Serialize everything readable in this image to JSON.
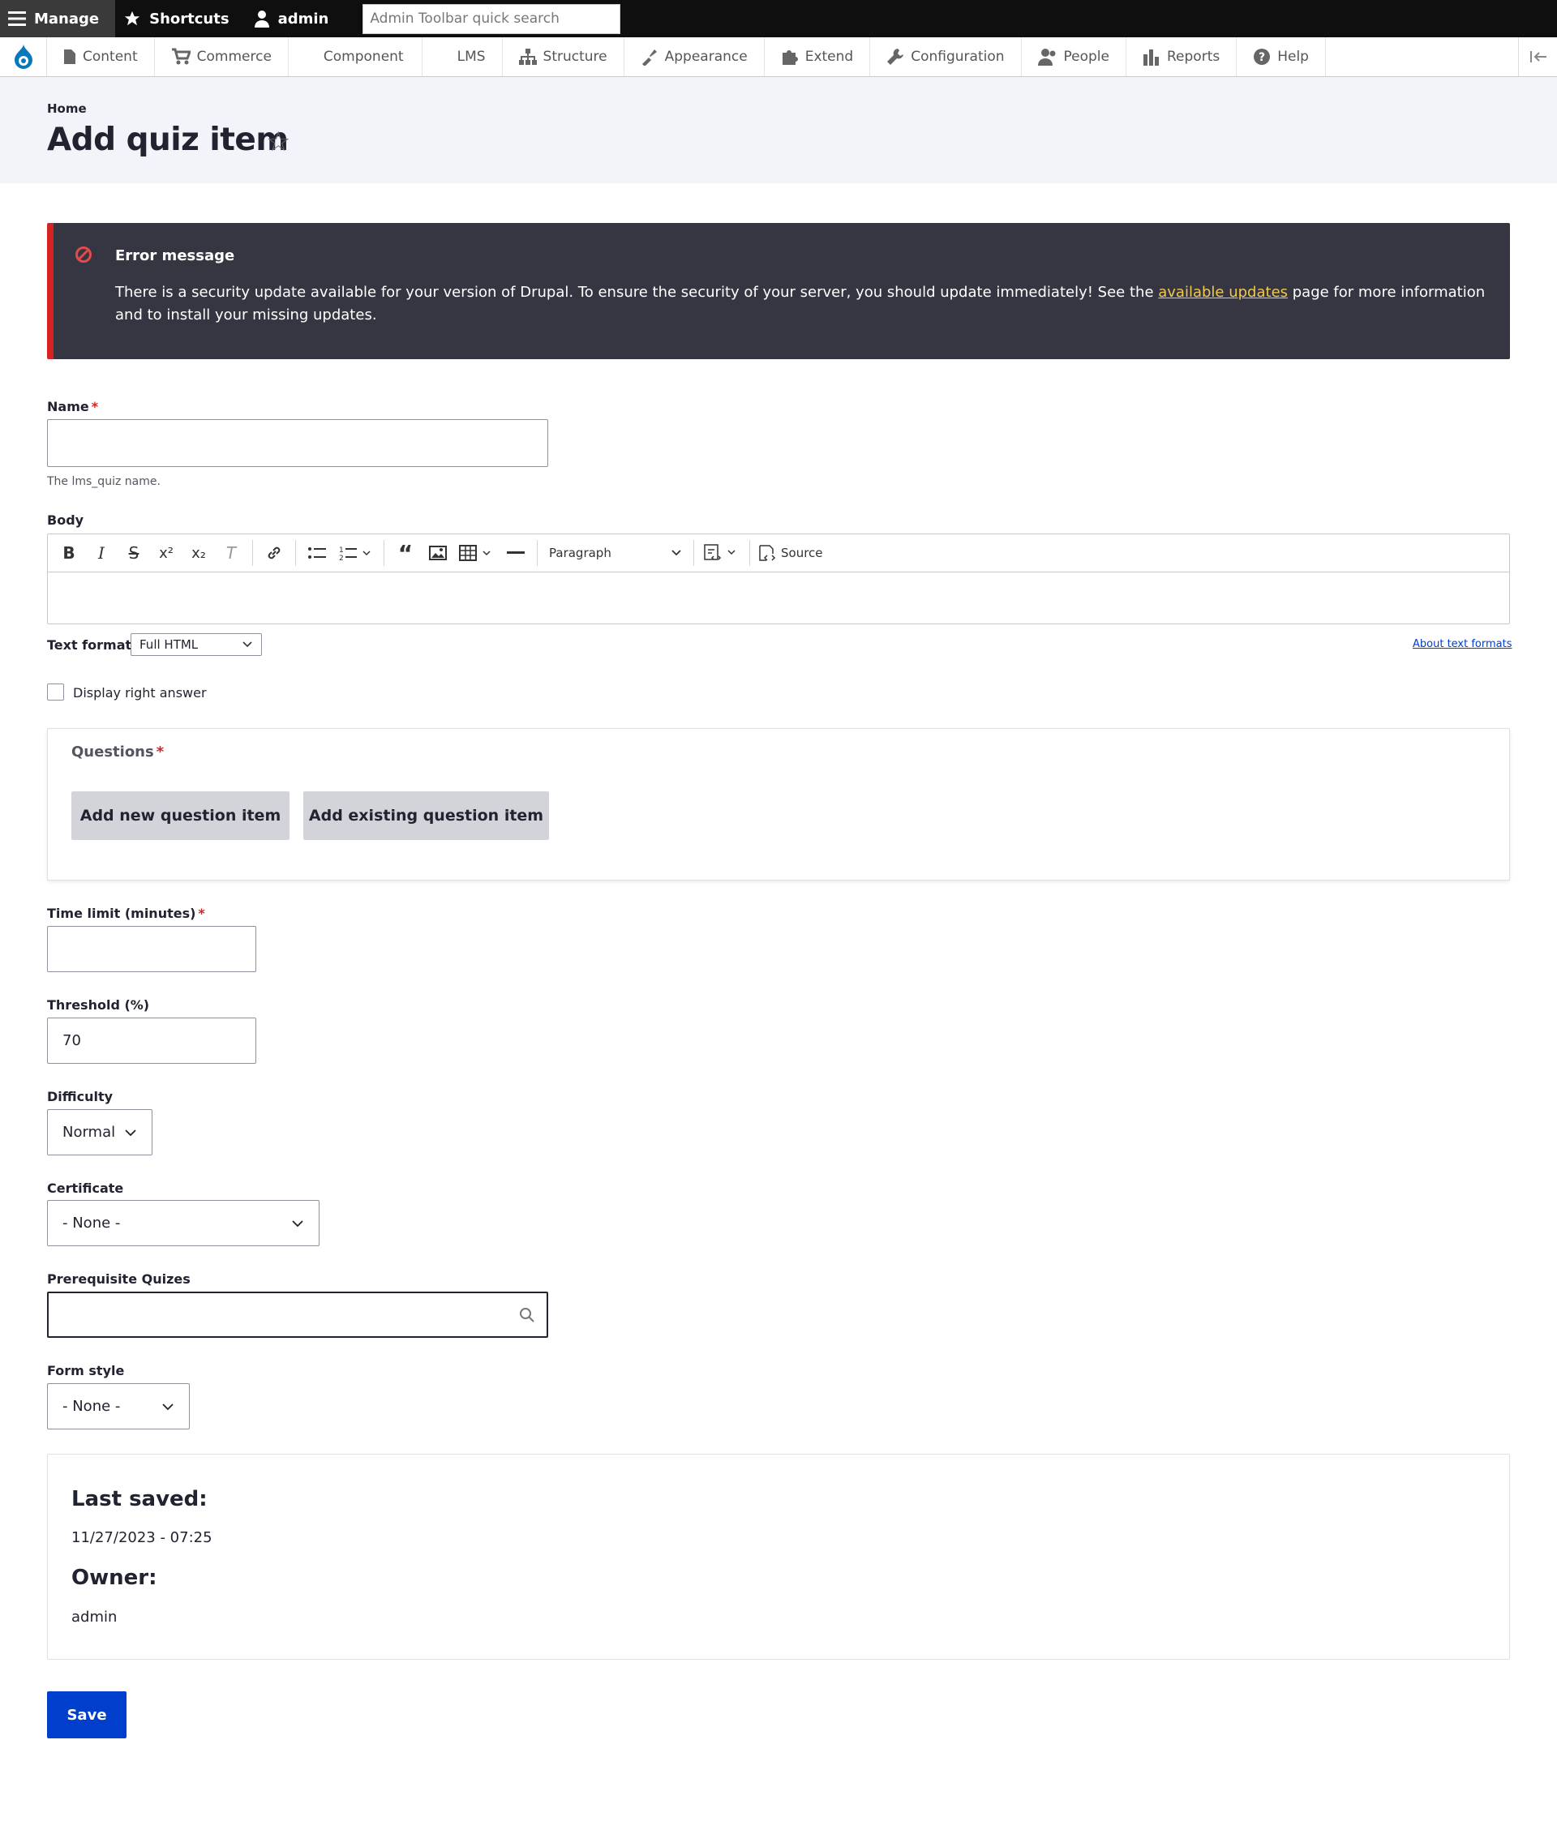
{
  "toolbar": {
    "manage": "Manage",
    "shortcuts": "Shortcuts",
    "user": "admin",
    "search_placeholder": "Admin Toolbar quick search"
  },
  "menu": {
    "items": [
      {
        "label": "Content",
        "icon": "page-icon"
      },
      {
        "label": "Commerce",
        "icon": "cart-icon"
      },
      {
        "label": "Component",
        "icon": ""
      },
      {
        "label": "LMS",
        "icon": ""
      },
      {
        "label": "Structure",
        "icon": "sitemap-icon"
      },
      {
        "label": "Appearance",
        "icon": "brush-icon"
      },
      {
        "label": "Extend",
        "icon": "puzzle-icon"
      },
      {
        "label": "Configuration",
        "icon": "wrench-icon"
      },
      {
        "label": "People",
        "icon": "people-icon"
      },
      {
        "label": "Reports",
        "icon": "bar-chart-icon"
      },
      {
        "label": "Help",
        "icon": "help-icon"
      }
    ]
  },
  "header": {
    "breadcrumb": "Home",
    "title": "Add quiz item"
  },
  "error": {
    "title": "Error message",
    "text_before": "There is a security update available for your version of Drupal. To ensure the security of your server, you should update immediately! See the ",
    "link": "available updates",
    "text_after": " page for more information and to install your missing updates."
  },
  "form": {
    "name_label": "Name",
    "name_value": "",
    "name_desc": "The lms_quiz name.",
    "body_label": "Body",
    "paragraph": "Paragraph",
    "source": "Source",
    "text_format_label": "Text format",
    "text_format_value": "Full HTML",
    "about_link": "About text formats",
    "display_answer": "Display right answer",
    "questions_label": "Questions",
    "add_new": "Add new question item",
    "add_existing": "Add existing question item",
    "time_limit_label": "Time limit (minutes)",
    "time_limit_value": "",
    "threshold_label": "Threshold (%)",
    "threshold_value": "70",
    "difficulty_label": "Difficulty",
    "difficulty_value": "Normal",
    "certificate_label": "Certificate",
    "certificate_value": "- None -",
    "prereq_label": "Prerequisite Quizes",
    "prereq_value": "",
    "form_style_label": "Form style",
    "form_style_value": "- None -"
  },
  "meta": {
    "last_saved_label": "Last saved:",
    "last_saved_value": "11/27/2023 - 07:25",
    "owner_label": "Owner:",
    "owner_value": "admin"
  },
  "actions": {
    "save": "Save"
  },
  "colors": {
    "primary": "#003ecc",
    "error_bg": "#353641",
    "error_accent": "#d72222",
    "link_yellow": "#f2c94c"
  }
}
